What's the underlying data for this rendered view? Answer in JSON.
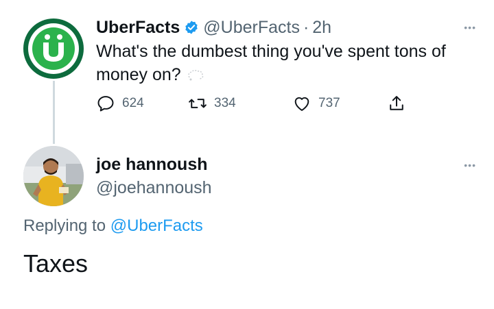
{
  "tweet": {
    "author": {
      "display_name": "UberFacts",
      "handle": "@UberFacts",
      "verified": true,
      "avatar_icon": "uberfacts-u-logo",
      "avatar_letter": "Ü"
    },
    "separator": "·",
    "time": "2h",
    "text": "What's the dumbest thing you've spent tons of money on?",
    "text_icon": "thinking-face-icon",
    "more_icon": "more-icon",
    "actions": {
      "reply_count": "624",
      "retweet_count": "334",
      "like_count": "737",
      "share_icon": "share-icon"
    }
  },
  "reply": {
    "author": {
      "display_name": "joe hannoush",
      "handle": "@joehannoush",
      "avatar_icon": "user-avatar-photo"
    },
    "replying_prefix": "Replying to",
    "replying_handle": "@UberFacts",
    "text": "Taxes"
  },
  "colors": {
    "verified_blue": "#1d9bf0",
    "muted_text": "#536471",
    "uber_dark_green": "#0d6b3d",
    "uber_green": "#2bb24c"
  }
}
